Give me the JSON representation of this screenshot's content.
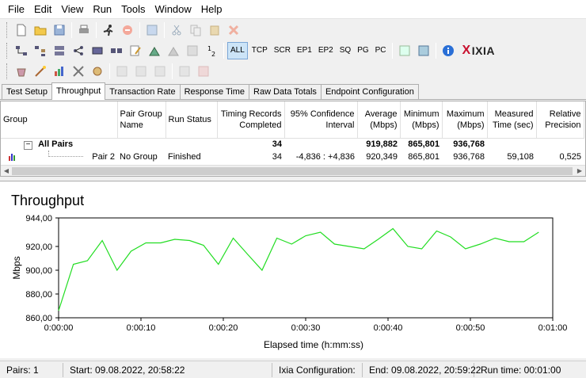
{
  "menu": [
    "File",
    "Edit",
    "View",
    "Run",
    "Tools",
    "Window",
    "Help"
  ],
  "toolbar_text": {
    "all": "ALL",
    "tcp": "TCP",
    "scr": "SCR",
    "ep1": "EP1",
    "ep2": "EP2",
    "sq": "SQ",
    "pg": "PG",
    "pc": "PC"
  },
  "logo": {
    "x": "X",
    "text": "IXIA"
  },
  "tabs": [
    "Test Setup",
    "Throughput",
    "Transaction Rate",
    "Response Time",
    "Raw Data Totals",
    "Endpoint Configuration"
  ],
  "table": {
    "headers": {
      "group": "Group",
      "pair_group": [
        "Pair Group",
        "Name"
      ],
      "run_status": "Run Status",
      "timing": [
        "Timing Records",
        "Completed"
      ],
      "confidence": [
        "95% Confidence",
        "Interval"
      ],
      "average": [
        "Average",
        "(Mbps)"
      ],
      "minimum": [
        "Minimum",
        "(Mbps)"
      ],
      "maximum": [
        "Maximum",
        "(Mbps)"
      ],
      "measured": [
        "Measured",
        "Time (sec)"
      ],
      "relative": [
        "Relative",
        "Precision"
      ]
    },
    "all_pairs": {
      "expander": "−",
      "label": "All Pairs",
      "timing": "34",
      "average": "919,882",
      "minimum": "865,801",
      "maximum": "936,768"
    },
    "pair2": {
      "name": "Pair 2",
      "group": "No Group",
      "status": "Finished",
      "timing": "34",
      "confidence": "-4,836 : +4,836",
      "average": "920,349",
      "minimum": "865,801",
      "maximum": "936,768",
      "measured": "59,108",
      "relative": "0,525"
    }
  },
  "chart_data": {
    "type": "line",
    "title": "Throughput",
    "xlabel": "Elapsed time (h:mm:ss)",
    "ylabel": "Mbps",
    "xlim": [
      0,
      60
    ],
    "ylim": [
      860,
      944
    ],
    "yticks": [
      860,
      880,
      900,
      920,
      944
    ],
    "ytick_labels": [
      "860,00",
      "880,00",
      "900,00",
      "920,00",
      "944,00"
    ],
    "xticks": [
      0,
      10,
      20,
      30,
      40,
      50,
      60
    ],
    "xtick_labels": [
      "0:00:00",
      "0:00:10",
      "0:00:20",
      "0:00:30",
      "0:00:40",
      "0:00:50",
      "0:01:00"
    ],
    "series_color": "#22dd22",
    "series": [
      {
        "x": [
          0,
          1.8,
          3.5,
          5.3,
          7.1,
          8.8,
          10.6,
          12.4,
          14.1,
          15.9,
          17.6,
          19.4,
          21.2,
          23,
          24.7,
          26.5,
          28.3,
          30,
          31.8,
          33.5,
          35.3,
          37.1,
          38.8,
          40.6,
          42.4,
          44.1,
          45.9,
          47.6,
          49.4,
          51.2,
          53,
          54.7,
          56.5,
          58.3
        ],
        "y": [
          866,
          905,
          908,
          925,
          900,
          916,
          923,
          923,
          926,
          925,
          921,
          905,
          927,
          913,
          900,
          927,
          922,
          929,
          932,
          922,
          920,
          918,
          926,
          935,
          920,
          918,
          933,
          928,
          918,
          922,
          927,
          924,
          924,
          932
        ]
      }
    ]
  },
  "status": {
    "pairs": "Pairs: 1",
    "start": "Start: 09.08.2022, 20:58:22",
    "ixia": "Ixia Configuration:",
    "end": "End: 09.08.2022, 20:59:22",
    "runtime": "Run time: 00:01:00"
  },
  "icons": [
    "new-file-icon",
    "open-folder-icon",
    "save-icon",
    "print-icon",
    "run-icon",
    "stop-icon",
    "copy-icon"
  ]
}
